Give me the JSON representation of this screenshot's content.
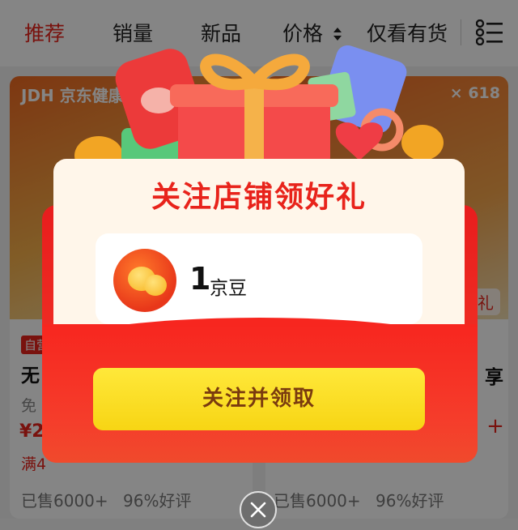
{
  "tabs": {
    "items": [
      {
        "label": "推荐",
        "active": true
      },
      {
        "label": "销量",
        "active": false
      },
      {
        "label": "新品",
        "active": false
      },
      {
        "label": "价格",
        "active": false
      },
      {
        "label": "仅看有货",
        "active": false
      }
    ],
    "price_sort_icon": "sort-updown-icon",
    "view_toggle_icon": "list-view-icon"
  },
  "cards": {
    "left": {
      "brand": "JDH 京东健康",
      "tag": "自营",
      "title": "无",
      "subtitle": "免",
      "price": "¥2",
      "promo": "满4",
      "sold": "已售6000+",
      "rating": "96%好评"
    },
    "right": {
      "badge": "× 618",
      "gift": "礼",
      "title_tail": "享",
      "sold": "已售6000+",
      "rating": "96%好评"
    }
  },
  "popup": {
    "title": "关注店铺领好礼",
    "reward": {
      "quantity": "1",
      "unit": "京豆",
      "icon": "jd-bean-icon"
    },
    "cta_label": "关注并领取",
    "close_icon": "close-icon"
  },
  "colors": {
    "accent_red": "#e8231b",
    "cta_yellow": "#f7d514",
    "cta_text": "#7a3b0f"
  }
}
